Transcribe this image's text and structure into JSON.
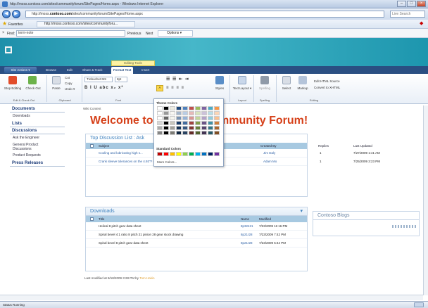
{
  "window": {
    "title": "http://moss.contoso.com/sites/communityforum/SitePages/Home.aspx - Windows Internet Explorer",
    "minimize": "–",
    "maximize": "□",
    "close": "×"
  },
  "address": {
    "url_prefix": "http://moss.",
    "url_domain": "contoso.com",
    "url_suffix": "/sites/communityforum/SitePages/Home.aspx",
    "back": "◀",
    "forward": "▶",
    "search_placeholder": "Live Search"
  },
  "favorites": {
    "label": "Favorites",
    "link": "http://moss.contoso.com/sites/communityforu..."
  },
  "find_bar": {
    "label": "Find:",
    "value": "term-note",
    "previous": "Previous",
    "next": "Next",
    "options": "Options ▾"
  },
  "ribbon_tabs": {
    "site_actions": "Site Actions ▾",
    "browse": "Browse",
    "edit": "Edit",
    "share": "Share & Track",
    "format_text": "Format Text",
    "insert": "Insert",
    "context": "Editing Tools"
  },
  "ribbon": {
    "stop_editing": "Stop Editing",
    "check_out": "Check Out",
    "edit_group": "Edit & Check Out",
    "paste": "Paste",
    "cut": "Cut",
    "copy": "Copy",
    "undo": "Undo ▾",
    "clipboard": "Clipboard",
    "font_name": "Trebuchet MS",
    "font_size": "8pt",
    "font_group": "Font",
    "styles": "Styles",
    "text_layout": "Text Layout ▾",
    "layout_group": "Layout",
    "spelling": "Spelling",
    "spelling_group": "Spelling",
    "select": "Select",
    "markup": "Markup",
    "edit_html": "Edit HTML Source",
    "convert_xhtml": "Convert to XHTML",
    "editing_group": "Editing",
    "format_marks": "B I U abc x₂ x²",
    "para_marks": "≡ ≡ ≡ ≡"
  },
  "palette": {
    "theme_colors": "Theme Colors",
    "standard_colors": "Standard Colors",
    "more_colors": "More Colors..."
  },
  "quick_launch": {
    "documents": "Documents",
    "downloads": "Downloads",
    "lists": "Lists",
    "discussions": "Discussions",
    "ask_engineer": "Ask the Engineer",
    "general_product_1": "General Product",
    "general_product_2": "Discussions",
    "product_requests": "Product Requests",
    "press_releases": "Press Releases"
  },
  "main": {
    "breadcrumb": "Wiki Content",
    "title_left": "Welcome to C",
    "title_right": "mmunity Forum!"
  },
  "discussion_list": {
    "title": "Top Discussion List : Ask",
    "columns": [
      "Subject",
      "Created By",
      "Replies",
      "Last Updated"
    ],
    "rows": [
      {
        "subject": "Cooling and lubricating high s...",
        "created_by": "Jim Daly",
        "replies": "1",
        "updated": "7/27/2009 1:41 AM"
      },
      {
        "subject": "Crank sleeve tolerances on the 4.93\"F differential",
        "created_by": "Adam Mo",
        "replies": "1",
        "updated": "7/25/2009 3:23 PM"
      }
    ]
  },
  "downloads": {
    "title": "Downloads",
    "menu": "▾",
    "columns": [
      "Title",
      "Name",
      "Modified"
    ],
    "rows": [
      {
        "title": "Helical 8 pitch gear data sheet",
        "name": "8p32421",
        "modified": "7/23/2009 11:16 PM"
      },
      {
        "title": "Spiral bevel 4:1 ratio 8 pitch 21 pinion 28 gear stock drawing",
        "name": "8p21r28",
        "modified": "7/23/2009 7:42 PM"
      },
      {
        "title": "Spiral bevel 8 pitch gear data sheet",
        "name": "8p21r28",
        "modified": "7/23/2009 5:44 PM"
      }
    ]
  },
  "blogs": {
    "title": "Contoso Blogs"
  },
  "footer": {
    "text": "Last modified at 8/18/2009 3:28 PM by",
    "user": "Tom Hakin"
  },
  "status": {
    "text": "Status Running"
  },
  "colors": {
    "title_red": "#d6411a",
    "banner": "#46b7c9",
    "nav_blue": "#2a4f82",
    "grid_header": "#a7c9e1"
  }
}
